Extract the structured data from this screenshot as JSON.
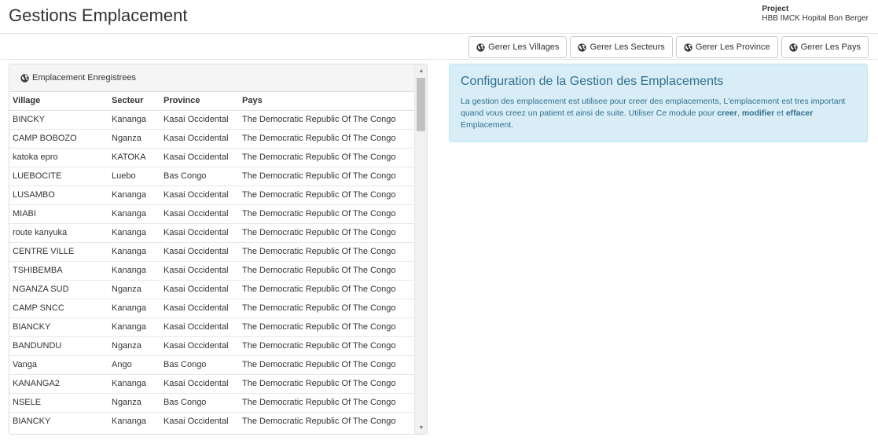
{
  "header": {
    "title": "Gestions Emplacement",
    "project_label": "Project",
    "project_name": "HBB IMCK Hopital Bon Berger"
  },
  "toolbar": {
    "buttons": [
      {
        "label": "Gerer Les Villages",
        "icon": "globe-icon"
      },
      {
        "label": "Gerer Les Secteurs",
        "icon": "globe-icon"
      },
      {
        "label": "Gerer Les Province",
        "icon": "globe-icon"
      },
      {
        "label": "Gerer Les Pays",
        "icon": "globe-icon"
      }
    ]
  },
  "panel": {
    "heading": "Emplacement Enregistrees",
    "icon": "globe-icon",
    "columns": [
      "Village",
      "Secteur",
      "Province",
      "Pays"
    ],
    "rows": [
      [
        "BINCKY",
        "Kananga",
        "Kasai Occidental",
        "The Democratic Republic Of The Congo"
      ],
      [
        "CAMP BOBOZO",
        "Nganza",
        "Kasai Occidental",
        "The Democratic Republic Of The Congo"
      ],
      [
        "katoka epro",
        "KATOKA",
        "Kasai Occidental",
        "The Democratic Republic Of The Congo"
      ],
      [
        "LUEBOCITE",
        "Luebo",
        "Bas Congo",
        "The Democratic Republic Of The Congo"
      ],
      [
        "LUSAMBO",
        "Kananga",
        "Kasai Occidental",
        "The Democratic Republic Of The Congo"
      ],
      [
        "MIABI",
        "Kananga",
        "Kasai Occidental",
        "The Democratic Republic Of The Congo"
      ],
      [
        "route kanyuka",
        "Kananga",
        "Kasai Occidental",
        "The Democratic Republic Of The Congo"
      ],
      [
        "CENTRE VILLE",
        "Kananga",
        "Kasai Occidental",
        "The Democratic Republic Of The Congo"
      ],
      [
        "TSHIBEMBA",
        "Kananga",
        "Kasai Occidental",
        "The Democratic Republic Of The Congo"
      ],
      [
        "NGANZA SUD",
        "Nganza",
        "Kasai Occidental",
        "The Democratic Republic Of The Congo"
      ],
      [
        "CAMP SNCC",
        "Kananga",
        "Kasai Occidental",
        "The Democratic Republic Of The Congo"
      ],
      [
        "BIANCKY",
        "Kananga",
        "Kasai Occidental",
        "The Democratic Republic Of The Congo"
      ],
      [
        "BANDUNDU",
        "Nganza",
        "Kasai Occidental",
        "The Democratic Republic Of The Congo"
      ],
      [
        "Vanga",
        "Ango",
        "Bas Congo",
        "The Democratic Republic Of The Congo"
      ],
      [
        "KANANGA2",
        "Kananga",
        "Kasai Occidental",
        "The Democratic Republic Of The Congo"
      ],
      [
        "NSELE",
        "Nganza",
        "Bas Congo",
        "The Democratic Republic Of The Congo"
      ],
      [
        "BIANCKY",
        "Kananga",
        "Kasai Occidental",
        "The Democratic Republic Of The Congo"
      ]
    ]
  },
  "info": {
    "title": "Configuration de la Gestion des Emplacements",
    "text_1": "La gestion des emplacement est utilisee pour creer des emplacements, L'emplacement est tres important quand vous creez un patient et ainsi de suite. Utiliser Ce module pour ",
    "bold_creer": "creer",
    "sep_1": ", ",
    "bold_modifier": "modifier",
    "sep_2": " et ",
    "bold_effacer": "effacer",
    "text_2": " Emplacement."
  },
  "colors": {
    "info_bg": "#d9edf7",
    "info_border": "#bce8f1",
    "info_text": "#31708f",
    "panel_heading_bg": "#f5f5f5"
  }
}
